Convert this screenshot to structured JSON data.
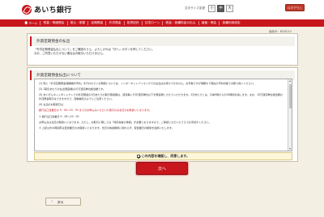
{
  "header": {
    "bank_name": "あいち銀行",
    "font_size_label": "文字サイズ変更",
    "font_sizes": [
      "小",
      "中",
      "大"
    ],
    "logout_label": "ログアウト"
  },
  "nav": {
    "items": [
      "ホーム",
      "残高・明細照会",
      "振込・振替",
      "定期預金",
      "外貨預金",
      "投資信託",
      "住宅ローン",
      "税金・各種料金の払込",
      "諸届・照会",
      "各種利用設定"
    ]
  },
  "screen_id": "画面ID：BDD010",
  "section1": {
    "title": "外貨定期預金の払出",
    "lines": [
      "「外貨定期預金払出について」をご確認のうえ、よろしければ「次へ」ボタンを押してください。",
      "なお、ご同意いただけない場合はお取引いただけません。"
    ]
  },
  "section2": {
    "title": "外貨定期預金払出について",
    "paragraphs": [
      "(1) 既に「外貨定期預金満期解約予約」を行われている明細については、インターネットバンキングでの払出はお受けできません。お手数ですが満期まで現在の予約内容でお取り扱いください。",
      "(2) 1取引あたりの払出限度額は10万通貨単位相当額です。",
      "(3) あいぎんネットダイレクトでの外貨預金の1日あたりの取引限度額は、通貨毎に10万通貨単位以下を限度額とさせていただきます。1日あたりとは、午前0時からの24時間を指します。なお、10万通貨単位相当額の外貨預金取引はできますので、自動継続のようにご注意ください。",
      "(4) 払出のお取扱日は",
      "銀行窓口営業日の 9：00〜15：00 までのお申込みいただいた取引のみ当日のお取扱いとなります。"
    ],
    "highlight": "9：00〜15：00 までのお申込みいただいた取引のみ当日のお取扱いとなります。",
    "extra": [
      "① 銀行窓口営業日 9：00〜15：00",
      "お申込みは当日の取扱いとなります。ただし、お取引に際しては「特定為替の承認」が必要となりますので、ご承認いただいたうえでお手続きください。",
      "② 上記以外の時間帯は翌営業日のお取扱いとなります。当日の為替相場に関わらず、翌営業日の相場を適用いたします。"
    ],
    "confirm_label": "この内容を確認し、同意します。"
  },
  "buttons": {
    "next": "次へ",
    "back": "戻る"
  },
  "colors": {
    "brand_red": "#c8161d",
    "background": "#f4efe3"
  }
}
